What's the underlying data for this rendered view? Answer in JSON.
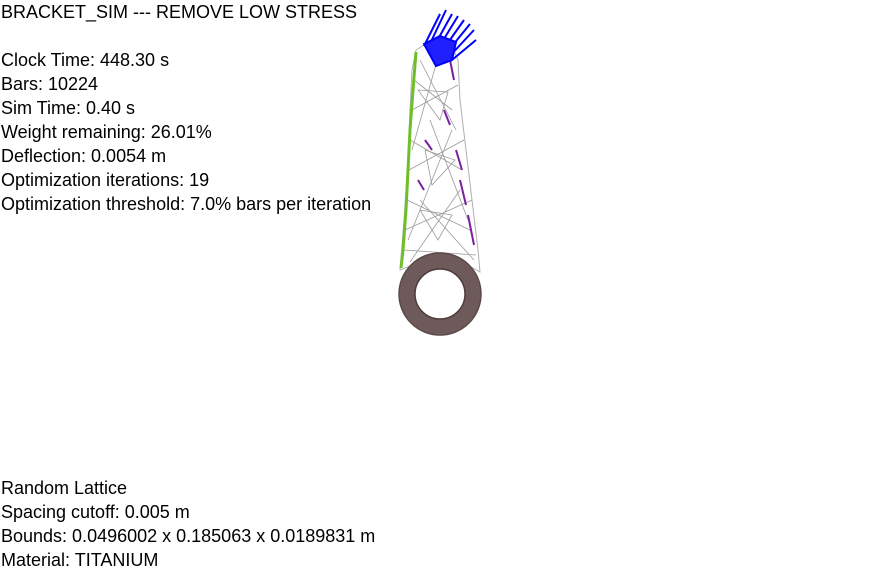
{
  "header": {
    "title": "BRACKET_SIM --- REMOVE LOW STRESS"
  },
  "stats": [
    "Clock Time: 448.30 s",
    "Bars: 10224",
    "Sim Time: 0.40 s",
    "Weight remaining: 26.01%",
    "Deflection: 0.0054 m",
    "Optimization iterations: 19",
    "Optimization threshold: 7.0% bars per iteration"
  ],
  "footer": [
    "Random Lattice",
    "Spacing cutoff: 0.005 m",
    "Bounds: 0.0496002 x 0.185063 x 0.0189831 m",
    "Material: TITANIUM"
  ],
  "colors": {
    "background": "#ffffff",
    "text": "#000000",
    "load_arrows": "#0000ff",
    "lattice": "#ffffff",
    "lattice_edge": "#b0b0b0",
    "high_stress": "#7a1fa0",
    "low_stress": "#6fbf2a",
    "mount_ring": "#6e5a5a"
  }
}
